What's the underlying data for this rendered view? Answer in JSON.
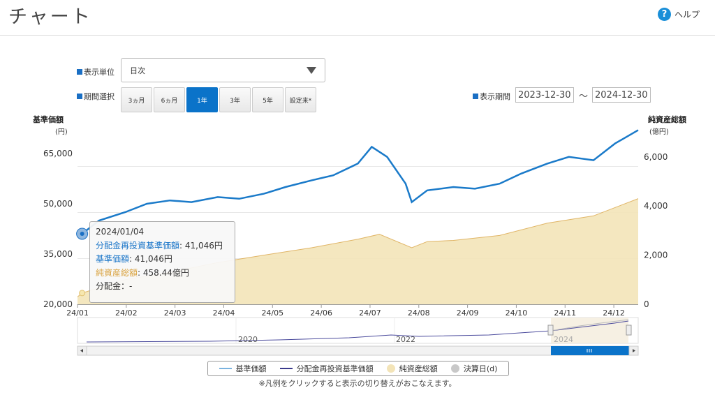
{
  "page": {
    "title": "チャート",
    "help_label": "ヘルプ",
    "help_glyph": "?"
  },
  "controls": {
    "unit_label": "表示単位",
    "unit_value": "日次",
    "period_label": "期間選択",
    "period_buttons": [
      "3ヵ月",
      "6ヵ月",
      "1年",
      "3年",
      "5年",
      "設定来*"
    ],
    "active_period": "1年",
    "range_label": "表示期間",
    "range_start": "2023-12-30",
    "range_end": "2024-12-30",
    "range_sep": "〜"
  },
  "axes": {
    "left_title": "基準価額",
    "left_unit": "(円)",
    "right_title": "純資産総額",
    "right_unit": "(億円)",
    "left_ticks": [
      "65,000",
      "50,000",
      "35,000",
      "20,000"
    ],
    "right_ticks": [
      "6,000",
      "4,000",
      "2,000",
      "0"
    ],
    "x_ticks": [
      "24/01",
      "24/02",
      "24/03",
      "24/04",
      "24/05",
      "24/06",
      "24/07",
      "24/08",
      "24/09",
      "24/10",
      "24/11",
      "24/12"
    ]
  },
  "tooltip": {
    "date": "2024/01/04",
    "reinvest_label": "分配金再投資基準価額",
    "reinvest_value": ": 41,046円",
    "nav_label": "基準価額",
    "nav_value": ": 41,046円",
    "aum_label": "純資産総額",
    "aum_value": ": 458.44億円",
    "dist": "分配金：-"
  },
  "navigator": {
    "labels": [
      "2020",
      "2022",
      "2024"
    ]
  },
  "legend": {
    "nav": "基準価額",
    "reinvest": "分配金再投資基準価額",
    "aum": "純資産総額",
    "settle": "決算日(d)"
  },
  "note": "※凡例をクリックすると表示の切り替えがおこなえます。",
  "colors": {
    "nav": "#1a7ac9",
    "reinvest": "#3a3a8c",
    "aum_fill": "#f3e4b8",
    "aum_line": "#e0b566",
    "accent": "#0b73c9"
  },
  "chart_data": {
    "type": "line",
    "x_axis": "date",
    "y_left_range": [
      20000,
      75000
    ],
    "y_right_range": [
      0,
      7500
    ],
    "series": [
      {
        "name": "基準価額",
        "axis": "left",
        "x": [
          "2024-01-01",
          "2024-01-04",
          "2024-01-15",
          "2024-02-01",
          "2024-02-15",
          "2024-03-01",
          "2024-03-15",
          "2024-04-01",
          "2024-04-15",
          "2024-05-01",
          "2024-05-15",
          "2024-06-01",
          "2024-06-15",
          "2024-07-01",
          "2024-07-10",
          "2024-07-20",
          "2024-08-01",
          "2024-08-05",
          "2024-08-15",
          "2024-09-01",
          "2024-09-15",
          "2024-10-01",
          "2024-10-15",
          "2024-11-01",
          "2024-11-15",
          "2024-12-01",
          "2024-12-15",
          "2024-12-30"
        ],
        "values": [
          41046,
          41046,
          45000,
          47500,
          50000,
          51000,
          50500,
          52000,
          51500,
          53000,
          55000,
          57000,
          58500,
          62000,
          67000,
          64000,
          56000,
          50500,
          54000,
          55000,
          54500,
          56000,
          59000,
          62000,
          64000,
          63000,
          68000,
          72000
        ]
      },
      {
        "name": "純資産総額",
        "axis": "right",
        "x": [
          "2024-01-01",
          "2024-01-04",
          "2024-02-01",
          "2024-03-01",
          "2024-04-01",
          "2024-05-01",
          "2024-06-01",
          "2024-07-01",
          "2024-07-15",
          "2024-08-05",
          "2024-08-15",
          "2024-09-01",
          "2024-10-01",
          "2024-11-01",
          "2024-12-01",
          "2024-12-30"
        ],
        "values": [
          300,
          458,
          1000,
          1300,
          1700,
          2000,
          2300,
          2650,
          2850,
          2300,
          2550,
          2600,
          2800,
          3300,
          3600,
          4300
        ]
      }
    ]
  }
}
